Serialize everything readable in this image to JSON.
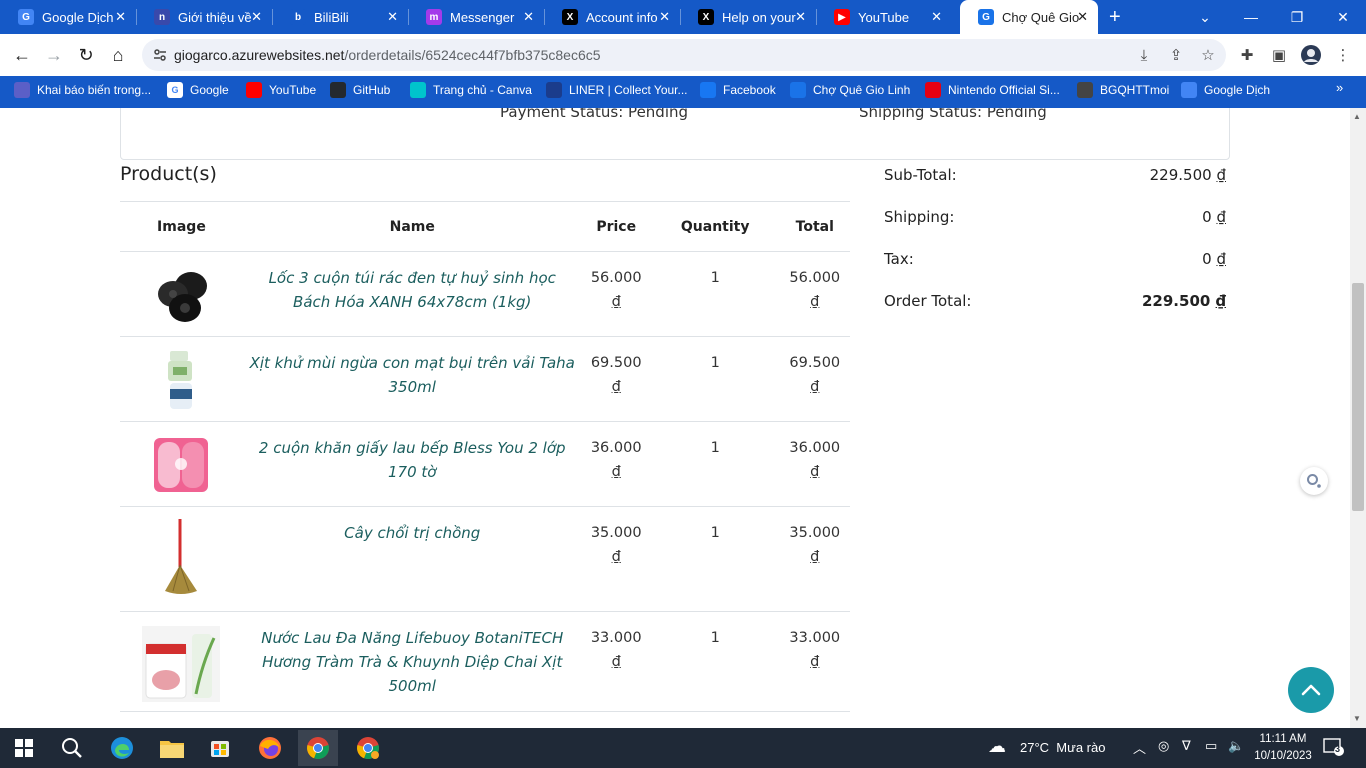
{
  "browser": {
    "tabs": [
      {
        "title": "Google Dịch",
        "icon": "google-translate-icon",
        "color": "#4285f4",
        "glyph": "G"
      },
      {
        "title": "Giới thiệu về",
        "icon": "notion-icon",
        "color": "#3949ab",
        "glyph": "n"
      },
      {
        "title": "BiliBili",
        "icon": "bilibili-icon",
        "color": "#1559c7",
        "glyph": "b"
      },
      {
        "title": "Messenger",
        "icon": "messenger-icon",
        "color": "#a33bea",
        "glyph": "m"
      },
      {
        "title": "Account info",
        "icon": "x-icon",
        "color": "#000000",
        "glyph": "X"
      },
      {
        "title": "Help on your",
        "icon": "x-icon",
        "color": "#000000",
        "glyph": "X"
      },
      {
        "title": "YouTube",
        "icon": "youtube-icon",
        "color": "#ff0000",
        "glyph": "▶"
      },
      {
        "title": "Chợ Quê Gio",
        "icon": "choque-icon",
        "color": "#1a73e8",
        "glyph": "G"
      }
    ],
    "url_host": "giogarco.azurewebsites.net",
    "url_path": "/orderdetails/6524cec44f7bfb375c8ec6c5",
    "bookmarks": [
      {
        "label": "Khai báo biến trong...",
        "icon": "bookmark-app-icon",
        "color": "#5b5fc7"
      },
      {
        "label": "Google",
        "icon": "google-icon",
        "color": "#ffffff"
      },
      {
        "label": "YouTube",
        "icon": "youtube-icon",
        "color": "#ff0000"
      },
      {
        "label": "GitHub",
        "icon": "github-icon",
        "color": "#24292e"
      },
      {
        "label": "Trang chủ - Canva",
        "icon": "canva-icon",
        "color": "#00c4cc"
      },
      {
        "label": "LINER | Collect Your...",
        "icon": "liner-icon",
        "color": "#1b3c8c"
      },
      {
        "label": "Facebook",
        "icon": "facebook-icon",
        "color": "#1877f2"
      },
      {
        "label": "Chợ Quê Gio Linh",
        "icon": "choque-icon",
        "color": "#1a73e8"
      },
      {
        "label": "Nintendo Official Si...",
        "icon": "nintendo-icon",
        "color": "#e60012"
      },
      {
        "label": "BGQHTTmoi",
        "icon": "globe-icon",
        "color": "#444444"
      },
      {
        "label": "Google Dịch",
        "icon": "google-translate-icon",
        "color": "#4285f4"
      }
    ]
  },
  "order": {
    "payment_status": "Payment Status: Pending",
    "shipping_status": "Shipping Status: Pending",
    "section_title": "Product(s)",
    "columns": [
      "Image",
      "Name",
      "Price",
      "Quantity",
      "Total"
    ],
    "items": [
      {
        "name": "Lốc 3 cuộn túi rác đen tự huỷ sinh học Bách Hóa XANH 64x78cm (1kg)",
        "price": "56.000",
        "qty": "1",
        "total": "56.000",
        "currency": "₫",
        "thumb": "trash-bags"
      },
      {
        "name": "Xịt khử mùi ngừa con mạt bụi trên vải Taha 350ml",
        "price": "69.500",
        "qty": "1",
        "total": "69.500",
        "currency": "₫",
        "thumb": "spray-bottle"
      },
      {
        "name": "2 cuộn khăn giấy lau bếp Bless You 2 lớp 170 tờ",
        "price": "36.000",
        "qty": "1",
        "total": "36.000",
        "currency": "₫",
        "thumb": "paper-towels"
      },
      {
        "name": "Cây chổi trị chồng",
        "price": "35.000",
        "qty": "1",
        "total": "35.000",
        "currency": "₫",
        "thumb": "broom"
      },
      {
        "name": "Nước Lau Đa Năng Lifebuoy BotaniTECH Hương Tràm Trà & Khuynh Diệp Chai Xịt 500ml",
        "price": "33.000",
        "qty": "1",
        "total": "33.000",
        "currency": "₫",
        "thumb": "cleaner-bottle"
      }
    ],
    "summary": {
      "subtotal_label": "Sub-Total:",
      "subtotal_value": "229.500",
      "shipping_label": "Shipping:",
      "shipping_value": "0",
      "tax_label": "Tax:",
      "tax_value": "0",
      "total_label": "Order Total:",
      "total_value": "229.500",
      "currency": "₫"
    }
  },
  "taskbar": {
    "temperature": "27°C",
    "weather": "Mưa rào",
    "time": "11:11 AM",
    "date": "10/10/2023",
    "notifications": "3"
  },
  "colors": {
    "browser_blue": "#1559c7",
    "product_link": "#1b5e5e",
    "back_to_top": "#1a9aa9"
  }
}
